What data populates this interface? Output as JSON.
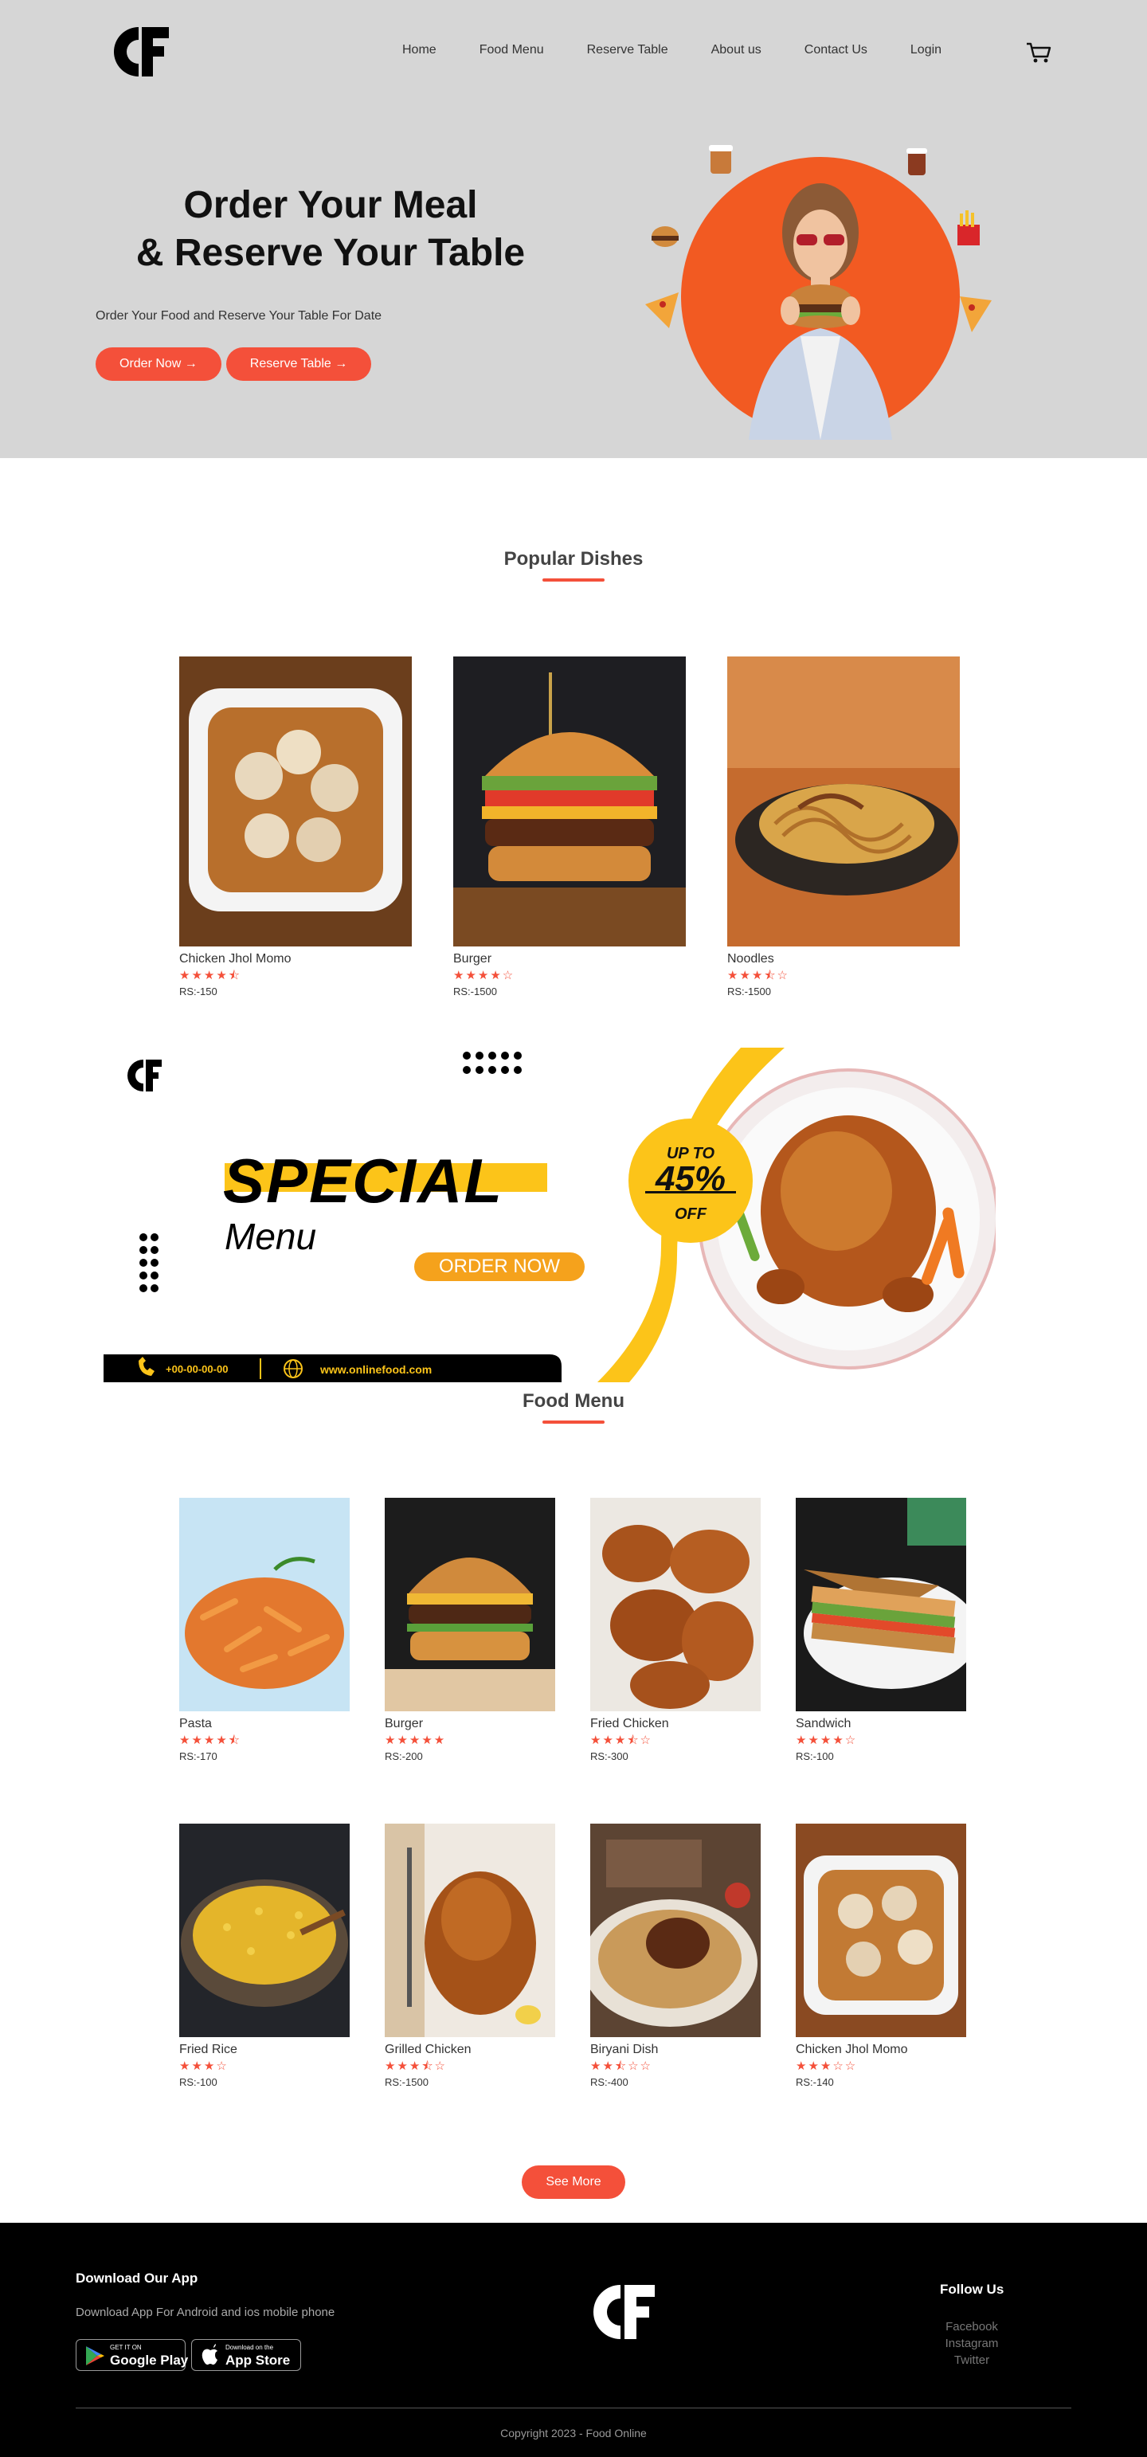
{
  "nav": {
    "logo_alt": "CF",
    "links": [
      "Home",
      "Food Menu",
      "Reserve Table",
      "About us",
      "Contact Us",
      "Login"
    ],
    "cart_icon": "cart-icon"
  },
  "hero": {
    "title_line1": "Order Your Meal",
    "title_line2": "& Reserve Your Table",
    "subtitle": "Order Your Food and Reserve Your Table For Date",
    "order_button": "Order Now →",
    "reserve_button": "Reserve Table →"
  },
  "popular": {
    "title": "Popular Dishes",
    "items": [
      {
        "name": "Chicken Jhol Momo",
        "stars": "★★★★⯪",
        "price": "RS:-150"
      },
      {
        "name": "Burger",
        "stars": "★★★★☆",
        "price": "RS:-1500"
      },
      {
        "name": "Noodles",
        "stars": "★★★⯪☆",
        "price": "RS:-1500"
      }
    ]
  },
  "special": {
    "heading": "SPECIAL",
    "sub": "Menu",
    "order_button": "ORDER NOW",
    "discount_top": "UP TO",
    "discount_value": "45%",
    "discount_bottom": "OFF",
    "phone": "+00-00-00-00",
    "website": "www.onlinefood.com"
  },
  "food_menu": {
    "title": "Food Menu",
    "row1": [
      {
        "name": "Pasta",
        "stars": "★★★★⯪",
        "price": "RS:-170"
      },
      {
        "name": "Burger",
        "stars": "★★★★★",
        "price": "RS:-200"
      },
      {
        "name": "Fried Chicken",
        "stars": "★★★⯪☆",
        "price": "RS:-300"
      },
      {
        "name": "Sandwich",
        "stars": "★★★★☆",
        "price": "RS:-100"
      }
    ],
    "row2": [
      {
        "name": "Fried Rice",
        "stars": "★★★☆",
        "price": "RS:-100"
      },
      {
        "name": "Grilled Chicken",
        "stars": "★★★⯪☆",
        "price": "RS:-1500"
      },
      {
        "name": "Biryani Dish",
        "stars": "★★⯪☆☆",
        "price": "RS:-400"
      },
      {
        "name": "Chicken Jhol Momo",
        "stars": "★★★☆☆",
        "price": "RS:-140"
      }
    ],
    "see_more": "See More"
  },
  "footer": {
    "app_title": "Download Our App",
    "app_sub": "Download App For Android and ios mobile phone",
    "google_small": "GET IT ON",
    "google_big": "Google Play",
    "apple_small": "Download on the",
    "apple_big": "App Store",
    "follow_title": "Follow Us",
    "social": [
      "Facebook",
      "Instagram",
      "Twitter"
    ],
    "copyright": "Copyright 2023 - Food Online"
  },
  "colors": {
    "accent": "#f4503a",
    "yellow": "#fcc419",
    "hero_bg": "#d6d6d6"
  }
}
